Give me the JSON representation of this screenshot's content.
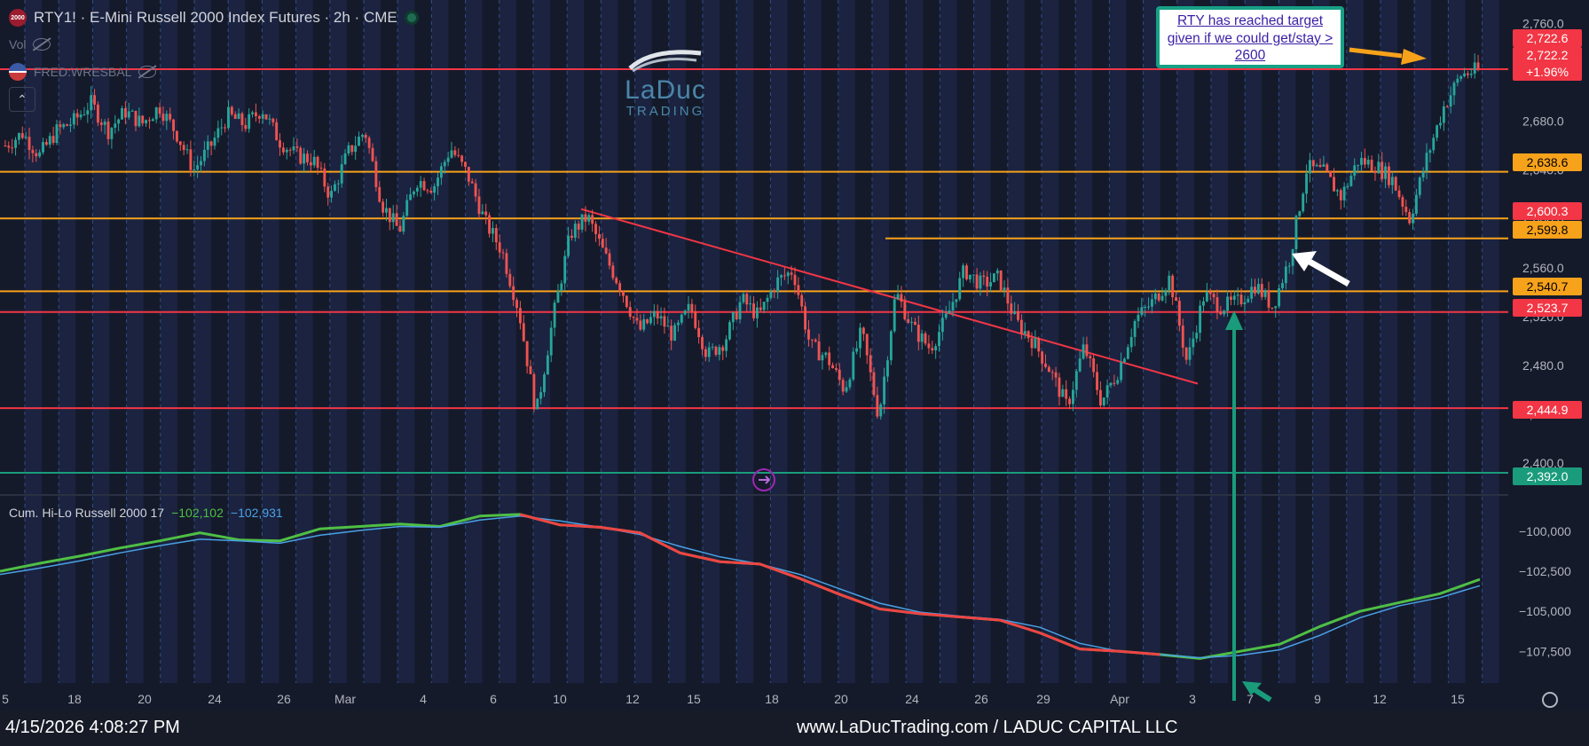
{
  "header": {
    "icon_text": "2000",
    "title": "RTY1! · E-Mini Russell 2000 Index Futures · 2h · CME",
    "vol_label": "Vol",
    "fred_label": "FRED:WRESBAL",
    "collapse_icon": "chevron-up-icon"
  },
  "logo": {
    "line1": "LaDuc",
    "line2": "TRADING"
  },
  "annotation": {
    "text": "RTY has reached target given if we could get/stay > 2600"
  },
  "indicator": {
    "name": "Cum. Hi-Lo Russell 2000 17",
    "value1": "−102,102",
    "value2": "−102,931"
  },
  "price_tags": [
    {
      "label": "2,722.6",
      "value": 2722.6,
      "bg": "#f23645",
      "fg": "#ffffff"
    },
    {
      "label": "2,722.2",
      "value": 2722.2,
      "bg": "#f23645",
      "fg": "#ffffff",
      "second_line": "+1.96%"
    },
    {
      "label": "2,638.6",
      "value": 2638.6,
      "bg": "#f7a21b",
      "fg": "#000000"
    },
    {
      "label": "2,600.3",
      "value": 2600.3,
      "bg": "#f23645",
      "fg": "#ffffff"
    },
    {
      "label": "2,599.8",
      "value": 2599.8,
      "bg": "#f7a21b",
      "fg": "#000000"
    },
    {
      "label": "2,540.7",
      "value": 2540.7,
      "bg": "#f7a21b",
      "fg": "#000000"
    },
    {
      "label": "2,523.7",
      "value": 2523.7,
      "bg": "#f23645",
      "fg": "#ffffff"
    },
    {
      "label": "2,444.9",
      "value": 2444.9,
      "bg": "#f23645",
      "fg": "#ffffff"
    },
    {
      "label": "2,392.0",
      "value": 2392.0,
      "bg": "#1a9c7c",
      "fg": "#ffffff"
    }
  ],
  "colors": {
    "up": "#26a69a",
    "down": "#ef5350",
    "orange": "#f7a21b",
    "red_line": "#f23645",
    "teal": "#1a9c7c",
    "bg": "#151a2b"
  },
  "footer": {
    "timestamp": "4/15/2026 4:08:27 PM",
    "site": "www.LaDucTrading.com / LADUC CAPITAL LLC"
  },
  "chart_data": [
    {
      "type": "candlestick",
      "title": "RTY1! · E-Mini Russell 2000 Index Futures · 2h · CME",
      "xlabel": "",
      "ylabel": "",
      "ylim": [
        2376,
        2772
      ],
      "y_ticks": [
        "2,760.0",
        "2,720.0",
        "2,680.0",
        "2,640.0",
        "2,600.0",
        "2,560.0",
        "2,520.0",
        "2,480.0",
        "2,440.0",
        "2,400.0"
      ],
      "x_ticks": [
        "5",
        "18",
        "20",
        "24",
        "26",
        "Mar",
        "4",
        "6",
        "10",
        "12",
        "15",
        "18",
        "20",
        "24",
        "26",
        "29",
        "Apr",
        "3",
        "7",
        "9",
        "12",
        "15"
      ],
      "price_path": [
        2660,
        2670,
        2652,
        2672,
        2680,
        2695,
        2672,
        2688,
        2678,
        2692,
        2670,
        2640,
        2660,
        2685,
        2677,
        2690,
        2664,
        2652,
        2648,
        2618,
        2654,
        2672,
        2612,
        2590,
        2632,
        2626,
        2658,
        2636,
        2598,
        2574,
        2524,
        2440,
        2520,
        2588,
        2602,
        2570,
        2542,
        2508,
        2522,
        2504,
        2528,
        2488,
        2500,
        2534,
        2520,
        2548,
        2558,
        2496,
        2486,
        2460,
        2508,
        2438,
        2540,
        2510,
        2494,
        2520,
        2558,
        2546,
        2552,
        2516,
        2500,
        2476,
        2446,
        2496,
        2450,
        2476,
        2518,
        2532,
        2552,
        2482,
        2538,
        2528,
        2532,
        2546,
        2528,
        2568,
        2642,
        2638,
        2618,
        2648,
        2644,
        2632,
        2600,
        2650,
        2692,
        2718,
        2722
      ],
      "horizontal_levels": [
        {
          "value": 2722.6,
          "color": "red"
        },
        {
          "value": 2638.6,
          "color": "orange"
        },
        {
          "value": 2600.3,
          "color": "orange"
        },
        {
          "value": 2584,
          "color": "orange",
          "start": "Mar 21"
        },
        {
          "value": 2540.7,
          "color": "orange"
        },
        {
          "value": 2523.7,
          "color": "red"
        },
        {
          "value": 2444.9,
          "color": "red"
        },
        {
          "value": 2392.0,
          "color": "teal"
        }
      ],
      "trendline": {
        "from": [
          2608,
          "Mar 10"
        ],
        "to": [
          2465,
          "Apr 2"
        ],
        "color": "red"
      }
    },
    {
      "type": "line",
      "title": "Cum. Hi-Lo Russell 2000 17",
      "ylim": [
        -109200,
        -98400
      ],
      "y_ticks": [
        "−100,000",
        "−102,500",
        "−105,000",
        "−107,500"
      ],
      "series": [
        {
          "name": "",
          "color": "#4fbf45",
          "values": [
            -102500,
            -102000,
            -101550,
            -101050,
            -100600,
            -100100,
            -100550,
            -100600,
            -99850,
            -99700,
            -99550,
            -99700,
            -99050,
            -98950,
            -99600,
            -99750,
            -100100,
            -101350,
            -101900,
            -102050,
            -102950,
            -103950,
            -104850,
            -105150,
            -105350,
            -105550,
            -106350,
            -107350,
            -107500,
            -107700,
            -107950,
            -107500,
            -107050,
            -105950,
            -105000,
            -104450,
            -103900,
            -103000
          ]
        },
        {
          "name": "",
          "color": "#4aa1e6",
          "values": [
            -102700,
            -102300,
            -101850,
            -101350,
            -100900,
            -100500,
            -100600,
            -100750,
            -100250,
            -99950,
            -99700,
            -99750,
            -99300,
            -99050,
            -99350,
            -99750,
            -100200,
            -100950,
            -101600,
            -102050,
            -102700,
            -103600,
            -104500,
            -105050,
            -105300,
            -105500,
            -106000,
            -107000,
            -107500,
            -107700,
            -107900,
            -107750,
            -107400,
            -106500,
            -105400,
            -104650,
            -104150,
            -103400
          ]
        }
      ]
    }
  ]
}
